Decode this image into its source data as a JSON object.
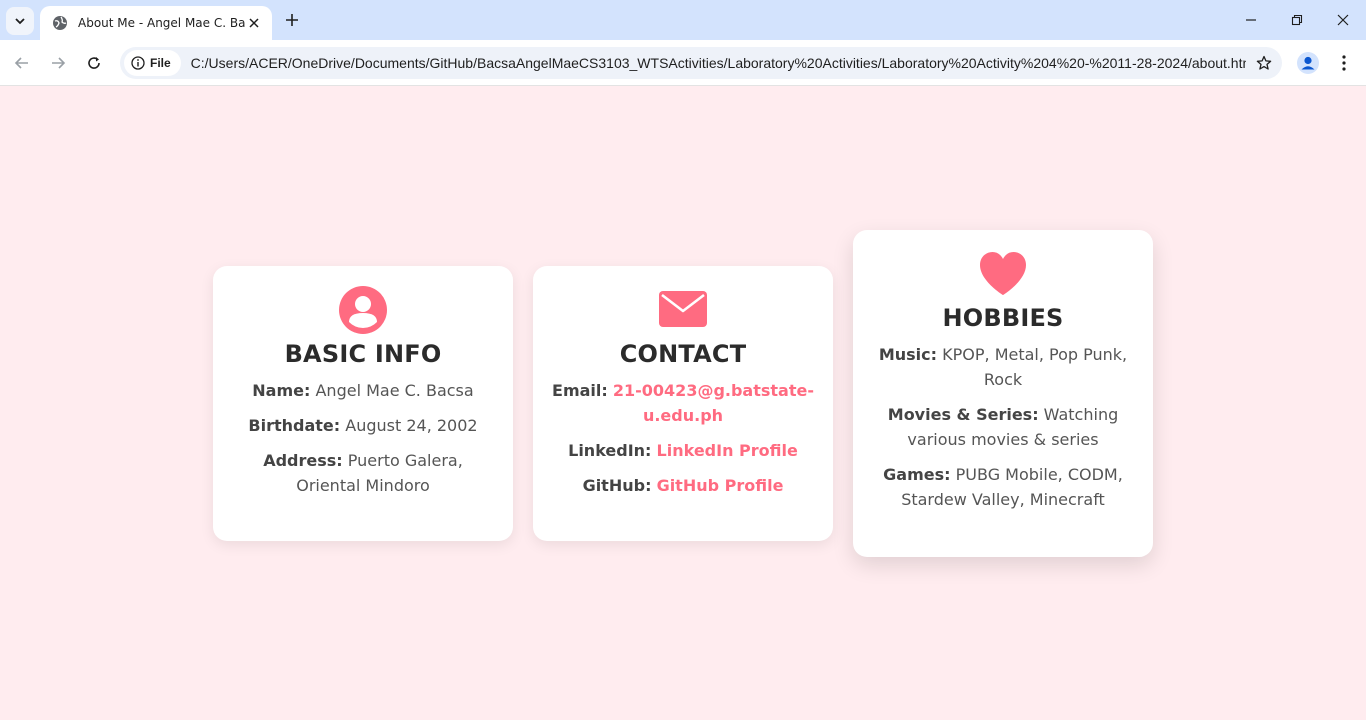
{
  "browser": {
    "tab_title": "About Me - Angel Mae C. Bacsa",
    "site_chip": "File",
    "url": "C:/Users/ACER/OneDrive/Documents/GitHub/BacsaAngelMaeCS3103_WTSActivities/Laboratory%20Activities/Laboratory%20Activity%204%20-%2011-28-2024/about.html",
    "icons": [
      "tab-search-icon",
      "globe-icon",
      "close-icon",
      "plus-icon",
      "minimize-icon",
      "restore-icon",
      "close-window-icon",
      "back-icon",
      "forward-icon",
      "reload-icon",
      "info-icon",
      "star-icon",
      "profile-icon",
      "kebab-menu-icon"
    ]
  },
  "colors": {
    "accent": "#ff6b81",
    "background": "#ffecef",
    "card": "#ffffff",
    "heading": "#2b2b2b"
  },
  "cards": {
    "basic": {
      "icon": "user-circle-icon",
      "title": "BASIC INFO",
      "name_label": "Name:",
      "name_value": " Angel Mae C. Bacsa",
      "birthdate_label": "Birthdate:",
      "birthdate_value": " August 24, 2002",
      "address_label": "Address:",
      "address_value": " Puerto Galera, Oriental Mindoro"
    },
    "contact": {
      "icon": "envelope-icon",
      "title": "CONTACT",
      "email_label": "Email:",
      "email_value": "21-00423@g.batstate-u.edu.ph",
      "linkedin_label": "LinkedIn:",
      "linkedin_value": "LinkedIn Profile",
      "github_label": "GitHub:",
      "github_value": "GitHub Profile"
    },
    "hobbies": {
      "icon": "heart-icon",
      "title": "HOBBIES",
      "music_label": "Music:",
      "music_value": " KPOP, Metal, Pop Punk, Rock",
      "movies_label": "Movies & Series:",
      "movies_value": " Watching various movies & series",
      "games_label": "Games:",
      "games_value": " PUBG Mobile, CODM, Stardew Valley, Minecraft"
    }
  }
}
